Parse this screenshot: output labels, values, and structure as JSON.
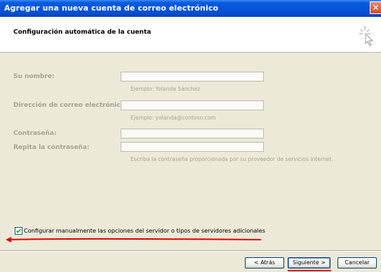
{
  "window": {
    "title": "Agregar una nueva cuenta de correo electrónico",
    "close_glyph": "✕"
  },
  "header": {
    "heading": "Configuración automática de la cuenta",
    "icon": "cursor-sparkle-icon"
  },
  "form": {
    "name_label": "Su nombre:",
    "name_value": "",
    "name_hint": "Ejemplo: Yolanda Sánchez",
    "email_label": "Dirección de correo electrónico:",
    "email_value": "",
    "email_hint": "Ejemplo: yolanda@contoso.com",
    "password_label": "Contraseña:",
    "password_value": "",
    "repeat_label": "Repita la contraseña:",
    "repeat_value": "",
    "password_hint": "Escriba la contraseña proporcionada por su proveedor de servicios Internet."
  },
  "manual": {
    "label": "Configurar manualmente las opciones del servidor o tipos de servidores adicionales",
    "checked": true
  },
  "buttons": {
    "back": "< Atrás",
    "next": "Siguiente >",
    "cancel": "Cancelar"
  },
  "annotation_color": "#e00000"
}
